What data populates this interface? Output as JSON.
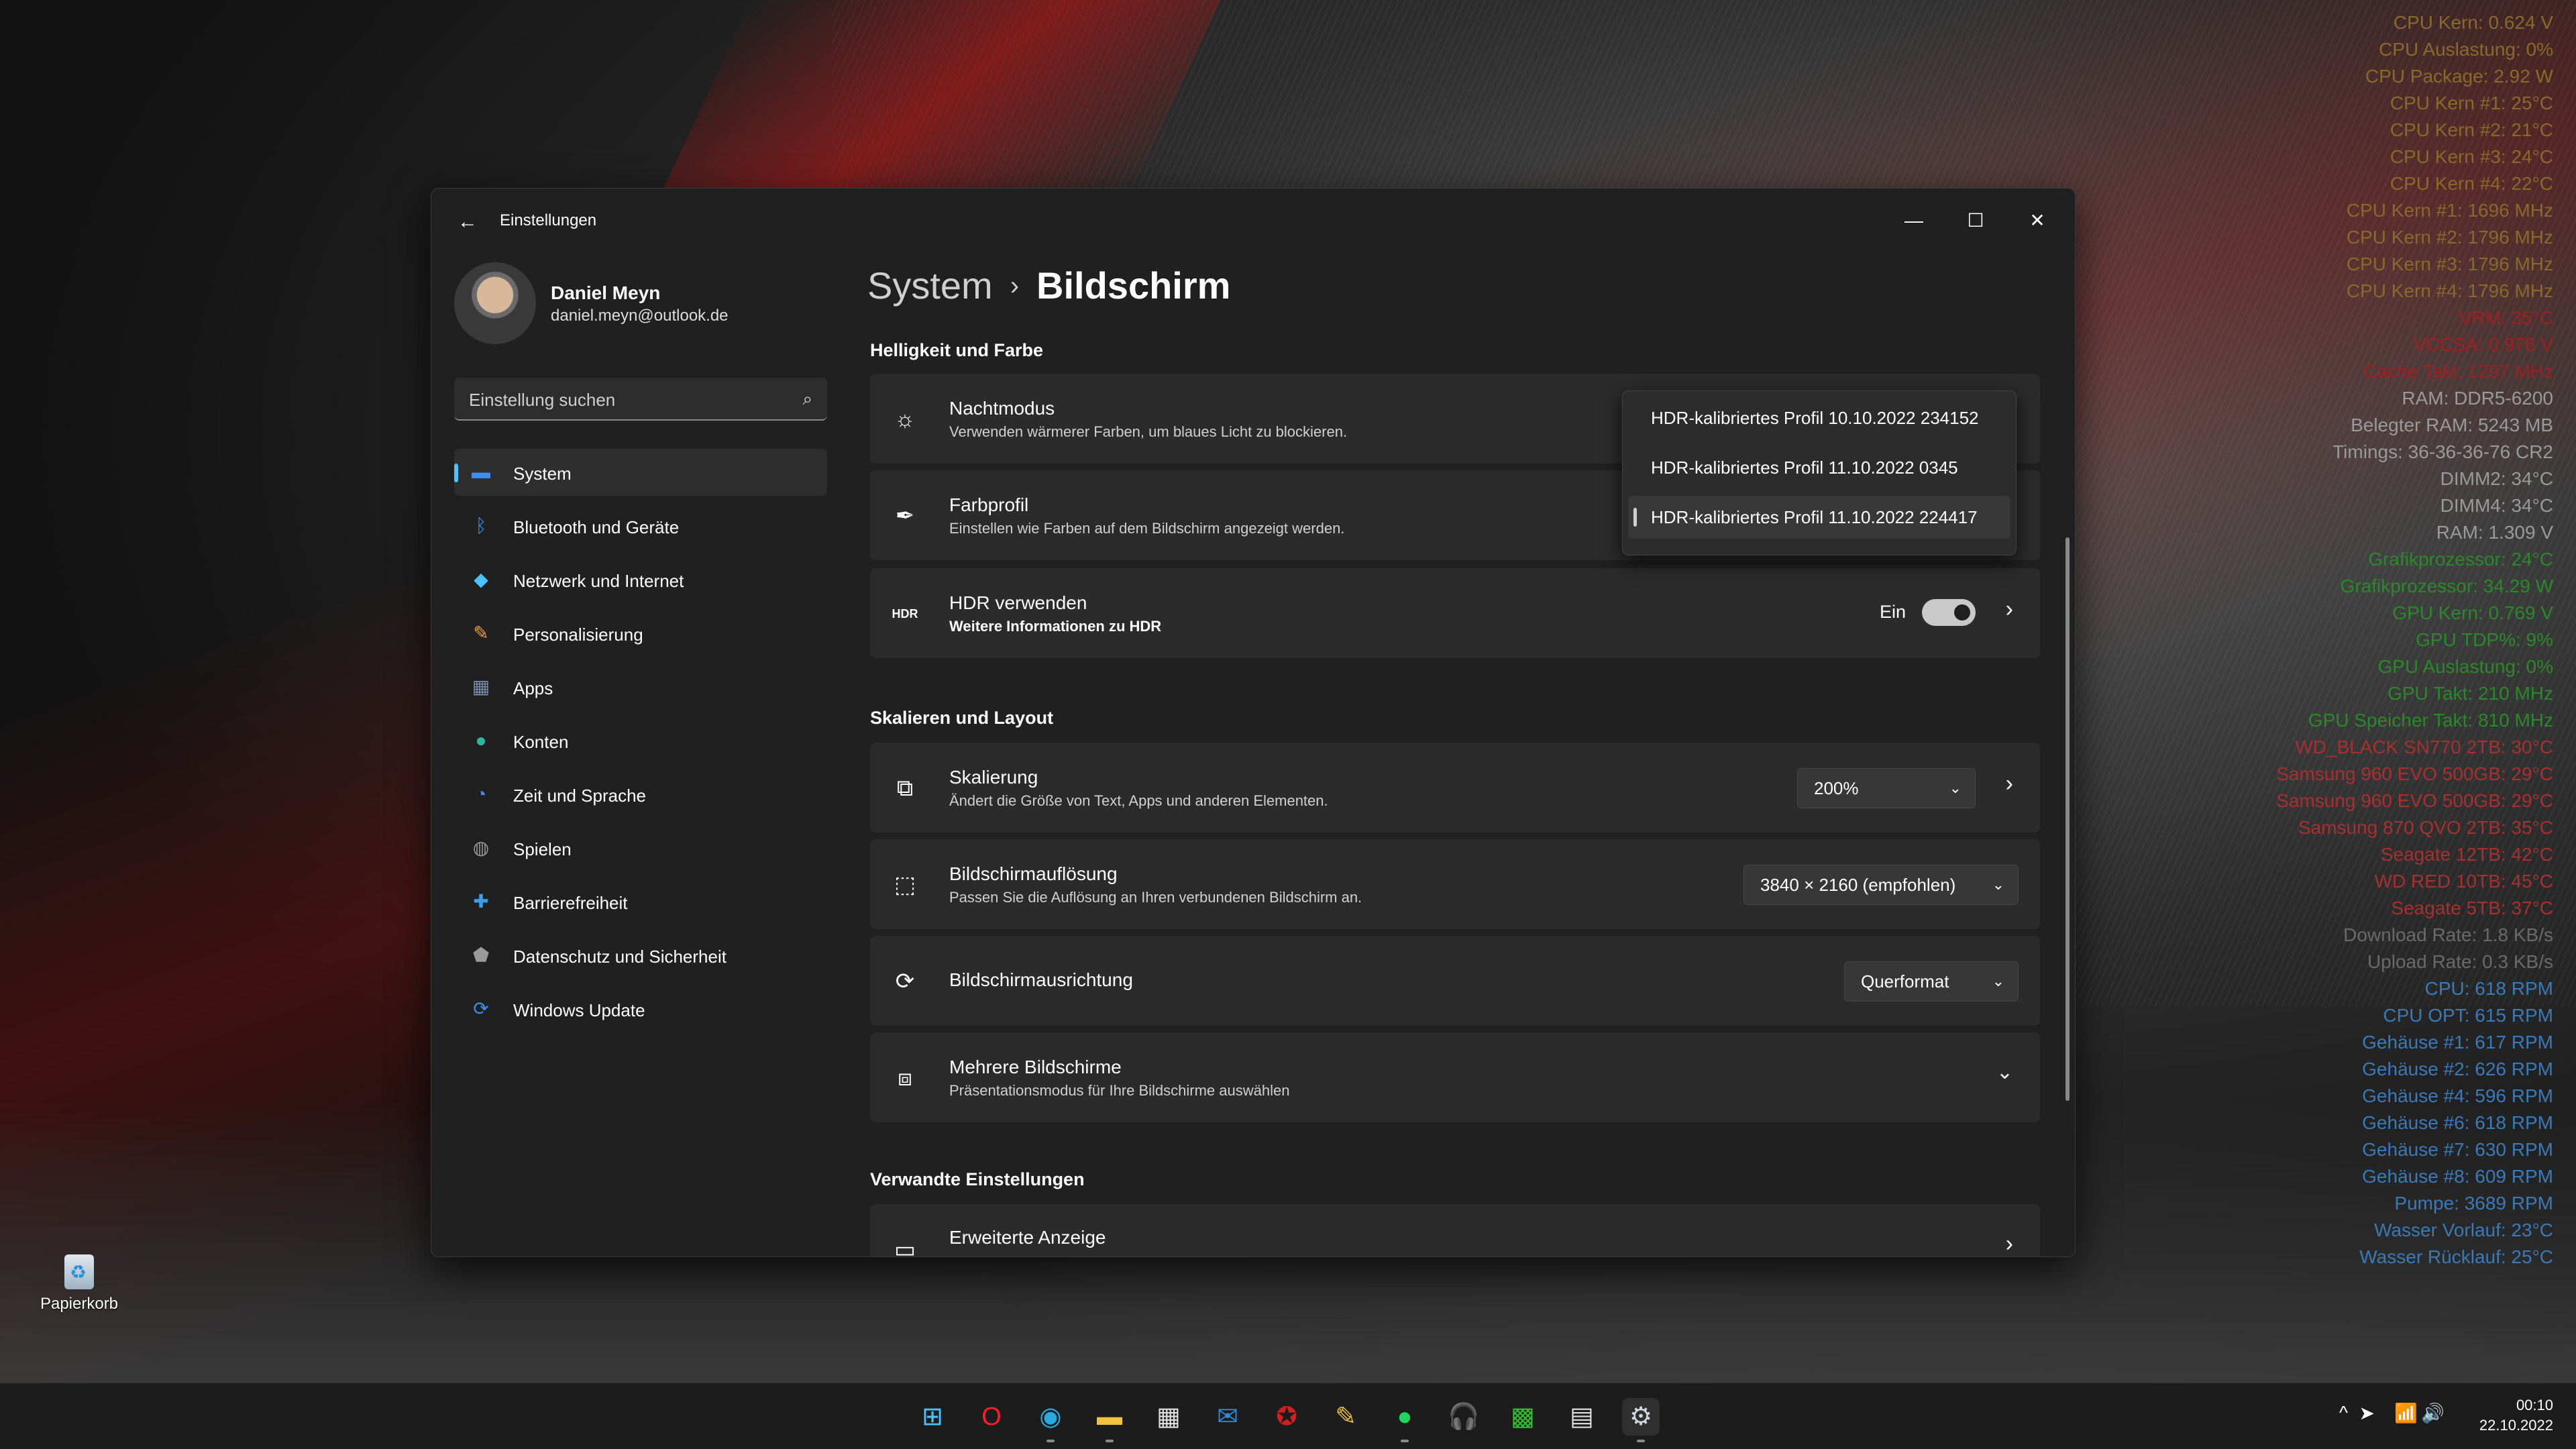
{
  "window": {
    "app_title": "Einstellungen",
    "controls": {
      "minimize": "—",
      "maximize": "☐",
      "close": "✕"
    }
  },
  "profile": {
    "name": "Daniel Meyn",
    "email": "daniel.meyn@outlook.de"
  },
  "search": {
    "placeholder": "Einstellung suchen"
  },
  "nav": [
    {
      "label": "System",
      "icon": "monitor-icon",
      "active": true,
      "color": "#3b8eea"
    },
    {
      "label": "Bluetooth und Geräte",
      "icon": "bluetooth-icon",
      "color": "#3b8eea"
    },
    {
      "label": "Netzwerk und Internet",
      "icon": "wifi-icon",
      "color": "#4cc2ff"
    },
    {
      "label": "Personalisierung",
      "icon": "brush-icon",
      "color": "#e8a040"
    },
    {
      "label": "Apps",
      "icon": "apps-icon",
      "color": "#7a8ca8"
    },
    {
      "label": "Konten",
      "icon": "person-icon",
      "color": "#2fb8a0"
    },
    {
      "label": "Zeit und Sprache",
      "icon": "globe-clock-icon",
      "color": "#3b8eea"
    },
    {
      "label": "Spielen",
      "icon": "gamepad-icon",
      "color": "#9a9a9a"
    },
    {
      "label": "Barrierefreiheit",
      "icon": "accessibility-icon",
      "color": "#3b9eea"
    },
    {
      "label": "Datenschutz und Sicherheit",
      "icon": "shield-icon",
      "color": "#9a9a9a"
    },
    {
      "label": "Windows Update",
      "icon": "update-icon",
      "color": "#3b8eea"
    }
  ],
  "breadcrumb": {
    "parent": "System",
    "separator": "›",
    "current": "Bildschirm"
  },
  "sections": {
    "brightness": "Helligkeit und Farbe",
    "scale": "Skalieren und Layout",
    "related": "Verwandte Einstellungen"
  },
  "cards": {
    "night": {
      "title": "Nachtmodus",
      "sub": "Verwenden wärmerer Farben, um blaues Licht zu blockieren."
    },
    "color_profile": {
      "title": "Farbprofil",
      "sub": "Einstellen wie Farben auf dem Bildschirm angezeigt werden."
    },
    "hdr": {
      "title": "HDR verwenden",
      "sub": "Weitere Informationen zu HDR",
      "state": "Ein"
    },
    "scaling": {
      "title": "Skalierung",
      "sub": "Ändert die Größe von Text, Apps und anderen Elementen.",
      "value": "200%"
    },
    "resolution": {
      "title": "Bildschirmauflösung",
      "sub": "Passen Sie die Auflösung an Ihren verbundenen Bildschirm an.",
      "value": "3840 × 2160 (empfohlen)"
    },
    "orientation": {
      "title": "Bildschirmausrichtung",
      "value": "Querformat"
    },
    "multi": {
      "title": "Mehrere Bildschirme",
      "sub": "Präsentationsmodus für Ihre Bildschirme auswählen"
    },
    "advanced": {
      "title": "Erweiterte Anzeige"
    }
  },
  "flyout": {
    "options": [
      "HDR-kalibriertes Profil 10.10.2022 234152",
      "HDR-kalibriertes Profil 11.10.2022 0345",
      "HDR-kalibriertes Profil 11.10.2022 224417"
    ],
    "selected_index": 2
  },
  "desktop": {
    "recycle_bin": "Papierkorb"
  },
  "hwmon": [
    {
      "text": "CPU Kern: 0.624 V",
      "color": "#8a6a2a"
    },
    {
      "text": "CPU Auslastung: 0%",
      "color": "#8a6a2a"
    },
    {
      "text": "CPU Package: 2.92 W",
      "color": "#8a6a2a"
    },
    {
      "text": "CPU Kern #1: 25°C",
      "color": "#8a6a2a"
    },
    {
      "text": "CPU Kern #2: 21°C",
      "color": "#8a6a2a"
    },
    {
      "text": "CPU Kern #3: 24°C",
      "color": "#8a6a2a"
    },
    {
      "text": "CPU Kern #4: 22°C",
      "color": "#8a6a2a"
    },
    {
      "text": "CPU Kern #1: 1696 MHz",
      "color": "#8a6a2a"
    },
    {
      "text": "CPU Kern #2: 1796 MHz",
      "color": "#8a6a2a"
    },
    {
      "text": "CPU Kern #3: 1796 MHz",
      "color": "#8a6a2a"
    },
    {
      "text": "CPU Kern #4: 1796 MHz",
      "color": "#8a6a2a"
    },
    {
      "text": "VRM: 35°C",
      "color": "#a02020"
    },
    {
      "text": "VCCSA: 0.976 V",
      "color": "#a02020"
    },
    {
      "text": "Cache Takt: 1297 MHz",
      "color": "#a02020"
    },
    {
      "text": "RAM: DDR5-6200",
      "color": "#9a9a9a"
    },
    {
      "text": "Belegter RAM: 5243 MB",
      "color": "#9a9a9a"
    },
    {
      "text": "Timings: 36-36-36-76 CR2",
      "color": "#9a9a9a"
    },
    {
      "text": "DIMM2: 34°C",
      "color": "#9a9a9a"
    },
    {
      "text": "DIMM4: 34°C",
      "color": "#9a9a9a"
    },
    {
      "text": "RAM: 1.309 V",
      "color": "#9a9a9a"
    },
    {
      "text": "Grafikprozessor: 24°C",
      "color": "#2a8a2a"
    },
    {
      "text": "Grafikprozessor: 34.29 W",
      "color": "#2a8a2a"
    },
    {
      "text": "GPU Kern: 0.769 V",
      "color": "#2a8a2a"
    },
    {
      "text": "GPU TDP%: 9%",
      "color": "#2a8a2a"
    },
    {
      "text": "GPU Auslastung: 0%",
      "color": "#2a8a2a"
    },
    {
      "text": "GPU Takt: 210 MHz",
      "color": "#2a8a2a"
    },
    {
      "text": "GPU Speicher Takt: 810 MHz",
      "color": "#2a8a2a"
    },
    {
      "text": "WD_BLACK SN770 2TB: 30°C",
      "color": "#a83030"
    },
    {
      "text": "Samsung 960 EVO 500GB: 29°C",
      "color": "#a83030"
    },
    {
      "text": "Samsung 960 EVO 500GB: 29°C",
      "color": "#a83030"
    },
    {
      "text": "Samsung 870 QVO 2TB: 35°C",
      "color": "#a83030"
    },
    {
      "text": "Seagate 12TB: 42°C",
      "color": "#a83030"
    },
    {
      "text": "WD RED 10TB: 45°C",
      "color": "#a83030"
    },
    {
      "text": "Seagate 5TB: 37°C",
      "color": "#a83030"
    },
    {
      "text": "Download Rate: 1.8 KB/s",
      "color": "#6a6a6a"
    },
    {
      "text": "Upload Rate: 0.3 KB/s",
      "color": "#6a6a6a"
    },
    {
      "text": "CPU: 618 RPM",
      "color": "#3a7ab8"
    },
    {
      "text": "CPU OPT: 615 RPM",
      "color": "#3a7ab8"
    },
    {
      "text": "Gehäuse #1: 617 RPM",
      "color": "#3a7ab8"
    },
    {
      "text": "Gehäuse #2: 626 RPM",
      "color": "#3a7ab8"
    },
    {
      "text": "Gehäuse #4: 596 RPM",
      "color": "#3a7ab8"
    },
    {
      "text": "Gehäuse #6: 618 RPM",
      "color": "#3a7ab8"
    },
    {
      "text": "Gehäuse #7: 630 RPM",
      "color": "#3a7ab8"
    },
    {
      "text": "Gehäuse #8: 609 RPM",
      "color": "#3a7ab8"
    },
    {
      "text": "Pumpe: 3689 RPM",
      "color": "#3a7ab8"
    },
    {
      "text": "Wasser Vorlauf: 23°C",
      "color": "#3a7ab8"
    },
    {
      "text": "Wasser Rücklauf: 25°C",
      "color": "#3a7ab8"
    }
  ],
  "taskbar": {
    "apps": [
      {
        "name": "start-icon",
        "glyph": "⊞",
        "color": "#4cc2ff"
      },
      {
        "name": "opera-icon",
        "glyph": "O",
        "color": "#ff1b2d"
      },
      {
        "name": "edge-icon",
        "glyph": "◉",
        "color": "#2aa8e0"
      },
      {
        "name": "explorer-icon",
        "glyph": "▬",
        "color": "#f3c33b"
      },
      {
        "name": "store-icon",
        "glyph": "▦",
        "color": "#e0e0e0"
      },
      {
        "name": "mail-icon",
        "glyph": "✉",
        "color": "#2a8fd8"
      },
      {
        "name": "app-red-icon",
        "glyph": "✪",
        "color": "#d02020"
      },
      {
        "name": "app-yellow-icon",
        "glyph": "✎",
        "color": "#e8c030"
      },
      {
        "name": "spotify-icon",
        "glyph": "●",
        "color": "#1ed760"
      },
      {
        "name": "headphones-icon",
        "glyph": "🎧",
        "color": "#e0e0e0"
      },
      {
        "name": "app-green-icon",
        "glyph": "▩",
        "color": "#2fc02f"
      },
      {
        "name": "monitor-app-icon",
        "glyph": "▤",
        "color": "#e0e0e0"
      },
      {
        "name": "settings-icon",
        "glyph": "⚙",
        "color": "#cfd8e0"
      }
    ],
    "tray": {
      "chevron": "^",
      "wifi": "📶",
      "volume": "🔊"
    },
    "time": "00:10",
    "date": "22.10.2022"
  }
}
